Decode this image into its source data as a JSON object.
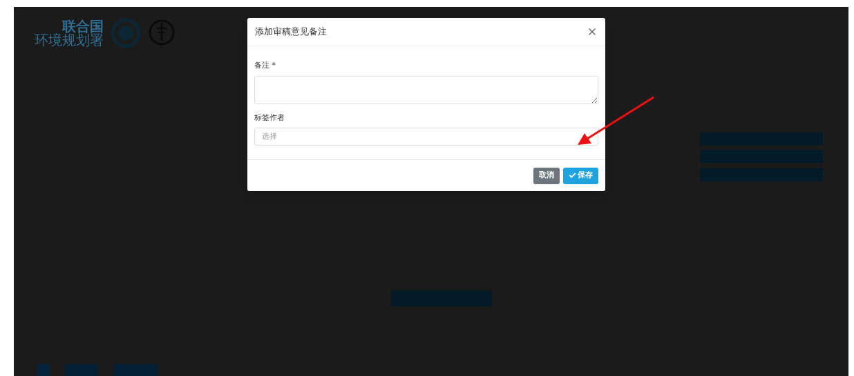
{
  "background": {
    "logo_lines": [
      "联合国",
      "环境规划署"
    ]
  },
  "dialog": {
    "title": "添加审稿意见备注",
    "fields": [
      {
        "kind": "textarea",
        "label": "备注 *"
      },
      {
        "kind": "select",
        "label": "标签作者",
        "placeholder": "选择"
      }
    ],
    "buttons": [
      {
        "kind": "secondary",
        "label": "取消"
      },
      {
        "kind": "primary",
        "label": "保存"
      }
    ]
  }
}
